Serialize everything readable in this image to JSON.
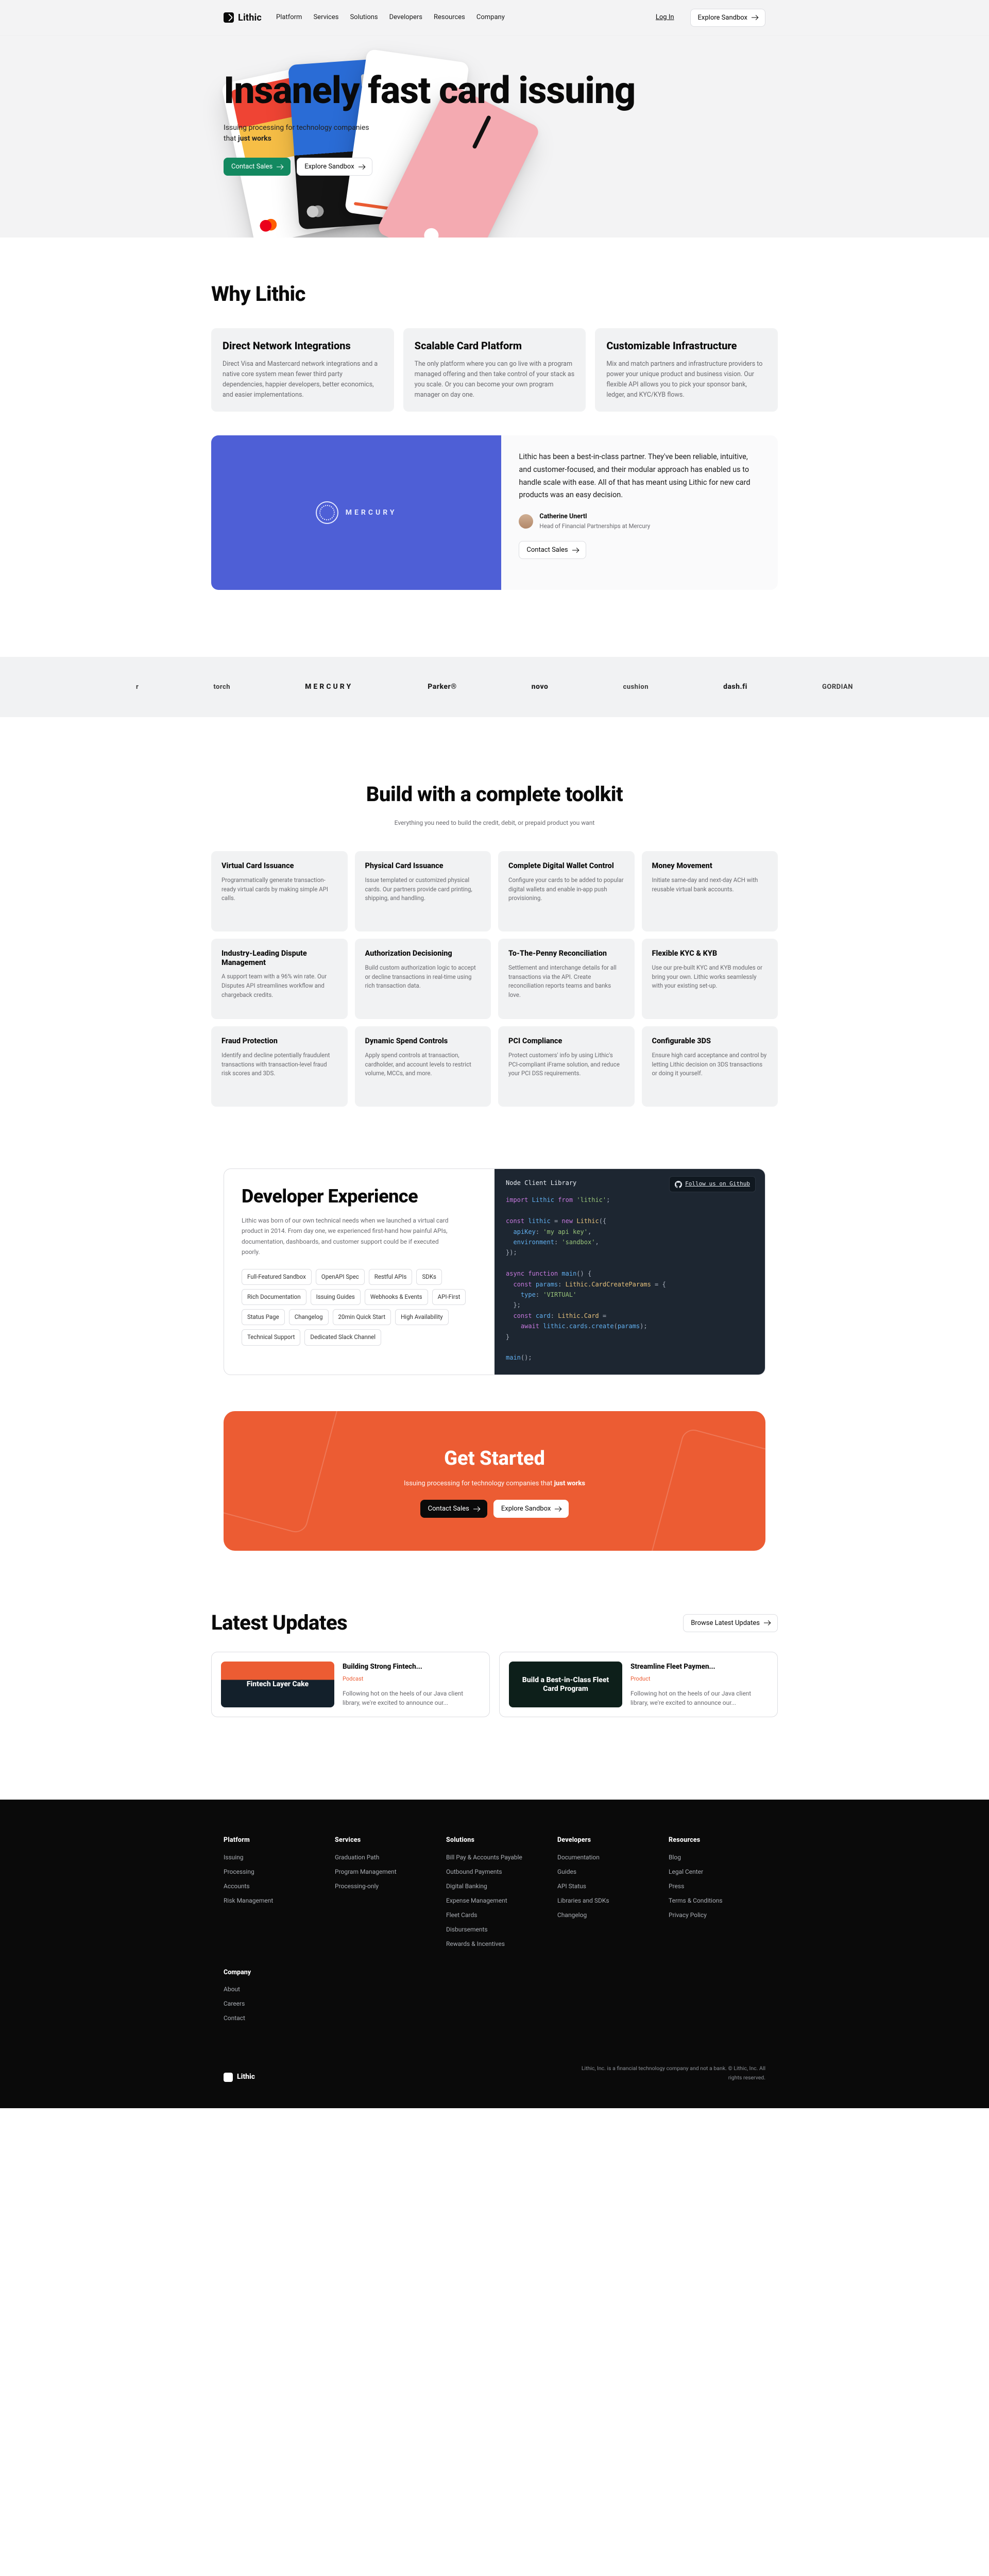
{
  "brand": "Lithic",
  "nav": {
    "links": [
      "Platform",
      "Services",
      "Solutions",
      "Developers",
      "Resources",
      "Company"
    ],
    "login": "Log In",
    "explore": "Explore Sandbox"
  },
  "hero": {
    "headline": "Insanely fast card issuing",
    "sub_pre": "Issuing processing for technology companies that ",
    "sub_bold": "just works",
    "contact": "Contact Sales",
    "explore": "Explore Sandbox"
  },
  "why": {
    "heading": "Why Lithic",
    "cards": [
      {
        "title": "Direct Network Integrations",
        "body": "Direct Visa and Mastercard network integrations and a native core system mean fewer third party dependencies, happier developers, better economics, and easier implementations."
      },
      {
        "title": "Scalable Card Platform",
        "body": "The only platform where you can go live with a program managed offering and then take control of your stack as you scale. Or you can become your own program manager on day one."
      },
      {
        "title": "Customizable Infrastructure",
        "body": "Mix and match partners and infrastructure providers to power your unique product and business vision. Our flexible API allows you to pick your sponsor bank, ledger, and KYC/KYB flows."
      }
    ]
  },
  "testi": {
    "brand": "MERCURY",
    "quote": "Lithic has been a best-in-class partner. They've been reliable, intuitive, and customer-focused, and their modular approach has enabled us to handle scale with ease. All of that has meant using Lithic for new card products was an easy decision.",
    "name": "Catherine Unertl",
    "role": "Head of Financial Partnerships at Mercury",
    "cta": "Contact Sales"
  },
  "logos": [
    "r",
    "torch",
    "MERCURY",
    "Parker®",
    "novo",
    "cushion",
    "dash.fi",
    "GORDIAN"
  ],
  "toolkit": {
    "heading": "Build with a complete toolkit",
    "lead": "Everything you need to build the credit, debit, or prepaid product you want",
    "items": [
      {
        "t": "Virtual Card Issuance",
        "b": "Programmatically generate transaction-ready virtual cards by making simple API calls."
      },
      {
        "t": "Physical Card Issuance",
        "b": "Issue templated or customized physical cards. Our partners provide card printing, shipping, and handling."
      },
      {
        "t": "Complete Digital Wallet Control",
        "b": "Configure your cards to be added to popular digital wallets and enable in-app push provisioning."
      },
      {
        "t": "Money Movement",
        "b": "Initiate same-day and next-day ACH with reusable virtual bank accounts."
      },
      {
        "t": "Industry-Leading Dispute Management",
        "b": "A support team with a 96% win rate. Our Disputes API streamlines workflow and chargeback credits."
      },
      {
        "t": "Authorization Decisioning",
        "b": "Build custom authorization logic to accept or decline transactions in real-time using rich transaction data."
      },
      {
        "t": "To-The-Penny Reconciliation",
        "b": "Settlement and interchange details for all transactions via the API. Create reconciliation reports teams and banks love."
      },
      {
        "t": "Flexible KYC & KYB",
        "b": "Use our pre-built KYC and KYB modules or bring your own. Lithic works seamlessly with your existing set-up."
      },
      {
        "t": "Fraud Protection",
        "b": "Identify and decline potentially fraudulent transactions with transaction-level fraud risk scores and 3DS."
      },
      {
        "t": "Dynamic Spend Controls",
        "b": "Apply spend controls at transaction, cardholder, and account levels to restrict volume, MCCs, and more."
      },
      {
        "t": "PCI Compliance",
        "b": "Protect customers' info by using Lithic's PCI-compliant iFrame solution, and reduce your PCI DSS requirements."
      },
      {
        "t": "Configurable 3DS",
        "b": "Ensure high card acceptance and control by letting Lithic decision on 3DS transactions or doing it yourself."
      }
    ]
  },
  "dev": {
    "heading": "Developer Experience",
    "body": "Lithic was born of our own technical needs when we launched a virtual card product in 2014. From day one, we experienced first-hand how painful APIs, documentation, dashboards, and customer support could be if executed poorly.",
    "chips": [
      "Full-Featured Sandbox",
      "OpenAPI Spec",
      "Restful APIs",
      "SDKs",
      "Rich Documentation",
      "Issuing Guides",
      "Webhooks & Events",
      "API-First",
      "Status Page",
      "Changelog",
      "20min Quick Start",
      "High Availability",
      "Technical Support",
      "Dedicated Slack Channel"
    ],
    "tab": "Node Client Library",
    "gh": "Follow us on Github"
  },
  "cta": {
    "heading": "Get Started",
    "line_pre": "Issuing processing for technology companies that ",
    "line_bold": "just works",
    "contact": "Contact Sales",
    "explore": "Explore Sandbox"
  },
  "updates": {
    "heading": "Latest Updates",
    "browse": "Browse Latest Updates",
    "items": [
      {
        "thumb": "Fintech Layer Cake",
        "title": "Building Strong Fintech...",
        "tag": "Podcast",
        "body": "Following hot on the heels of our Java client library, we're excited to announce our..."
      },
      {
        "thumb": "Build a Best-in-Class Fleet Card Program",
        "title": "Streamline Fleet Paymen...",
        "tag": "Product",
        "body": "Following hot on the heels of our Java client library, we're excited to announce our..."
      }
    ]
  },
  "footer": {
    "cols": [
      {
        "h": "Platform",
        "links": [
          "Issuing",
          "Processing",
          "Accounts",
          "Risk Management"
        ]
      },
      {
        "h": "Services",
        "links": [
          "Graduation Path",
          "Program Management",
          "Processing-only"
        ]
      },
      {
        "h": "Solutions",
        "links": [
          "Bill Pay & Accounts Payable",
          "Outbound Payments",
          "Digital Banking",
          "Expense Management",
          "Fleet Cards",
          "Disbursements",
          "Rewards & Incentives"
        ]
      },
      {
        "h": "Developers",
        "links": [
          "Documentation",
          "Guides",
          "API Status",
          "Libraries and SDKs",
          "Changelog"
        ]
      },
      {
        "h": "Resources",
        "links": [
          "Blog",
          "Legal Center",
          "Press",
          "Terms & Conditions",
          "Privacy Policy"
        ]
      }
    ],
    "company": {
      "h": "Company",
      "links": [
        "About",
        "Careers",
        "Contact"
      ]
    },
    "brand": "Lithic",
    "disclaimer": "Lithic, Inc. is a financial technology company and not a bank. © Lithic, Inc. All rights reserved."
  }
}
